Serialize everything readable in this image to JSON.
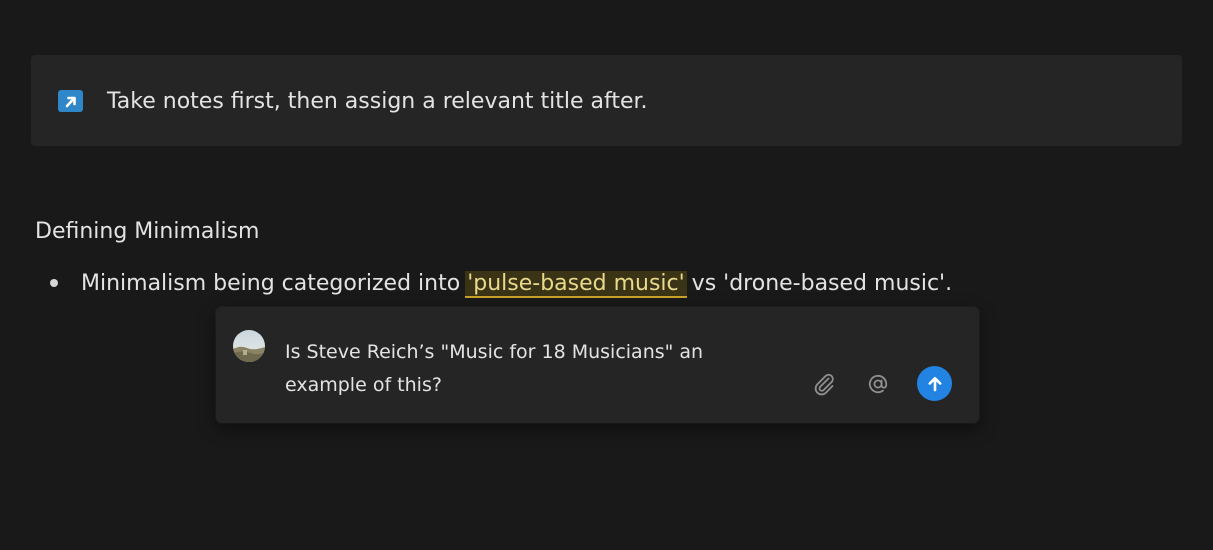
{
  "callout": {
    "icon": "arrow-up-right-icon",
    "text": "Take notes first, then assign a relevant title after."
  },
  "section": {
    "heading": "Defining Minimalism"
  },
  "bullet": {
    "before": "Minimalism being categorized into ",
    "highlighted": "'pulse-based music'",
    "after": " vs 'drone-based music'."
  },
  "comment": {
    "avatar": "user-avatar",
    "text": "Is Steve Reich’s \"Music for 18 Musicians\" an example of this?",
    "actions": {
      "attach_icon": "paperclip-icon",
      "mention_icon": "at-sign-icon",
      "send_icon": "arrow-up-icon"
    }
  },
  "colors": {
    "background": "#191919",
    "callout_bg": "#252525",
    "accent_blue": "#2383e2",
    "highlight_bg": "#3a3315",
    "highlight_underline": "#c9a227"
  }
}
